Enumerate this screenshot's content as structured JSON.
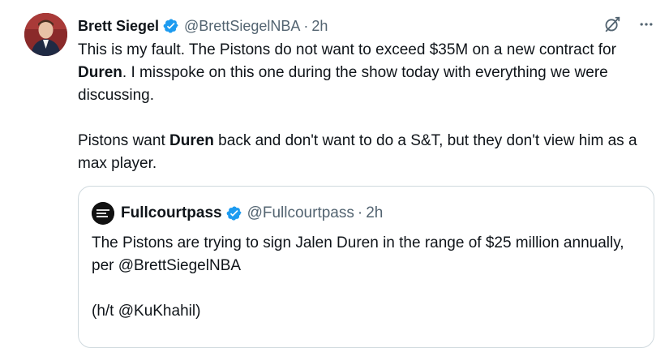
{
  "tweet": {
    "author_name": "Brett Siegel",
    "author_handle": "@BrettSiegelNBA",
    "separator": "·",
    "time": "2h",
    "para1_part1": "This is my fault. The Pistons do not want to exceed $35M on a new contract for ",
    "para1_bold": "Duren",
    "para1_part2": ". I misspoke on this one during the show today with everything we were discussing.",
    "para2_part1": "Pistons want ",
    "para2_bold": "Duren",
    "para2_part2": " back and don't want to do a S&T, but they don't view him as a max player."
  },
  "actions": {
    "grok_icon": "grok-icon",
    "more_icon": "more-icon"
  },
  "quote": {
    "author_name": "Fullcourtpass",
    "author_handle": "@Fullcourtpass",
    "separator": "·",
    "time": "2h",
    "para1": "The Pistons are trying to sign Jalen Duren in the range of $25 million annually, per @BrettSiegelNBA",
    "para2": "(h/t @KuKhahil)"
  },
  "colors": {
    "verified": "#1d9bf0",
    "secondary_text": "#536471",
    "border": "#cfd9de"
  }
}
